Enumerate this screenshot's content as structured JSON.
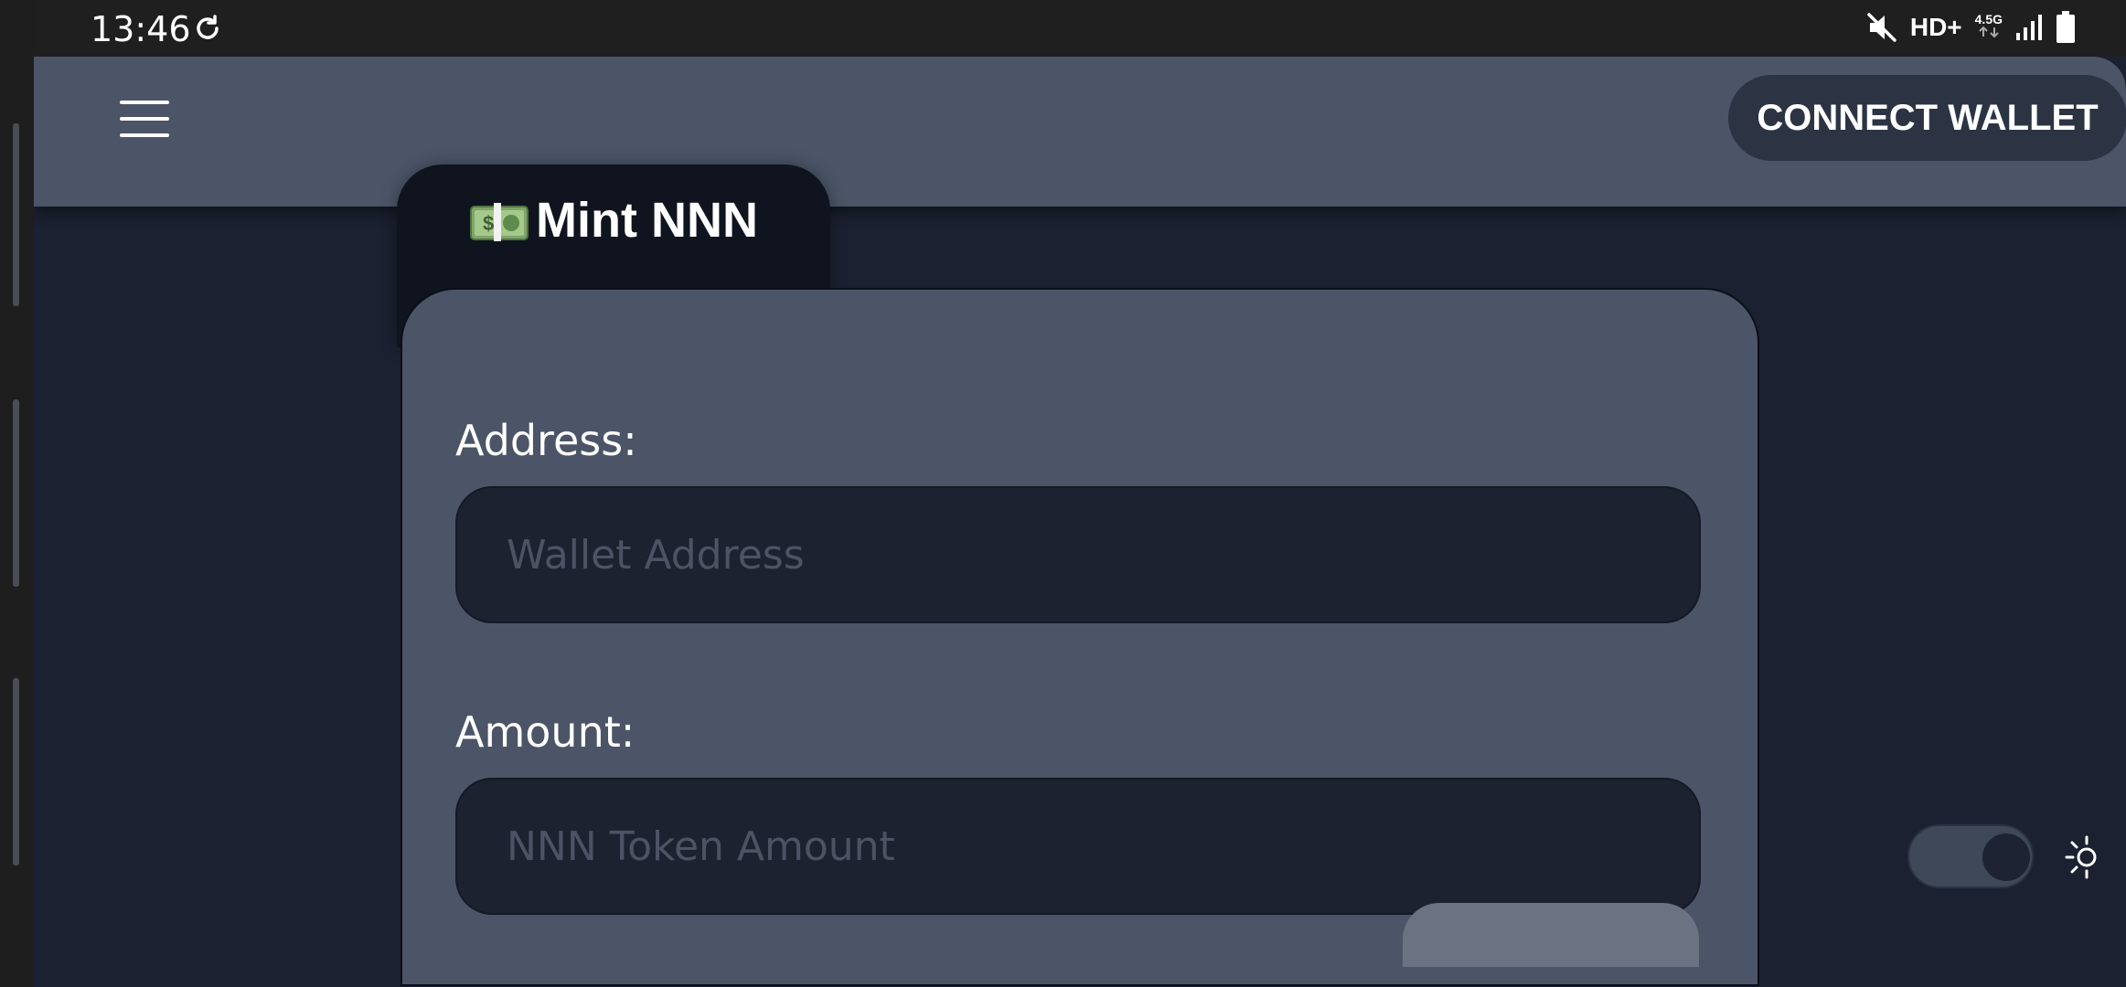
{
  "status_bar": {
    "time": "13:46",
    "hd_label": "HD+",
    "network_label": "4.5G",
    "icons": [
      "sync-icon",
      "mute-icon",
      "signal-icon",
      "battery-icon"
    ]
  },
  "header": {
    "menu_icon": "hamburger-menu-icon",
    "connect_wallet_label": "CONNECT WALLET"
  },
  "tab": {
    "icon": "money-banknote-icon",
    "title": "Mint NNN"
  },
  "form": {
    "address_label": "Address:",
    "address_placeholder": "Wallet Address",
    "address_value": "",
    "amount_label": "Amount:",
    "amount_placeholder": "NNN Token Amount",
    "amount_value": ""
  },
  "theme_toggle": {
    "icon": "sun-icon",
    "state": "dark"
  },
  "colors": {
    "header_bg": "#4b5567",
    "page_bg": "#1b2130",
    "card_bg": "#4b5567",
    "tab_bg": "#0f141e",
    "input_bg": "#1d2230",
    "button_bg": "#2c3444"
  }
}
